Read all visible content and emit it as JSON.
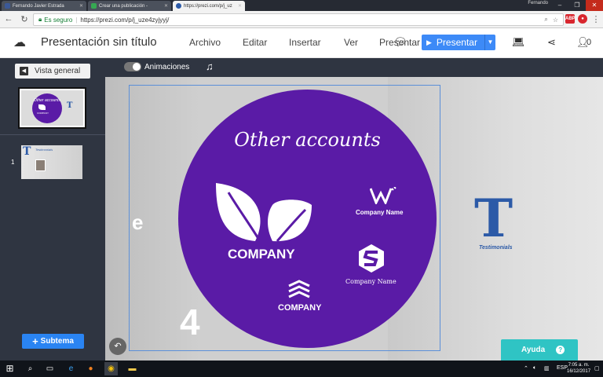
{
  "browser": {
    "tabs": [
      {
        "title": "Fernando Javier Estrada",
        "color": "#3b5998",
        "active": false
      },
      {
        "title": "Crear una publicación -",
        "color": "#36a852",
        "active": false
      },
      {
        "title": "https://prezi.com/p/j_uz",
        "color": "#2c5aa7",
        "active": true
      }
    ],
    "user": "Fernando",
    "secure_label": "Es seguro",
    "url": "https://prezi.com/p/j_uze4zyjyyj/"
  },
  "app": {
    "title": "Presentación sin título",
    "menu": [
      "Archivo",
      "Editar",
      "Insertar",
      "Ver",
      "Presentar"
    ],
    "present_label": "Presentar",
    "collab_count": "0"
  },
  "sidebar": {
    "overview_label": "Vista general",
    "thumb_number": "1",
    "thumb_title": "Testimonials",
    "subtopic_label": "Subtema"
  },
  "toolbar": {
    "animations_label": "Animaciones"
  },
  "canvas": {
    "circle_title": "Other accounts",
    "company_big": "COMPANY",
    "company_small": "COMPANY",
    "company_name_1": "Company Name",
    "company_name_2": "Company Name",
    "letter_e": "e",
    "number": "4",
    "testimonials_letter": "T",
    "testimonials_label": "Testimonials",
    "thumb_circle_title": "Other accounts",
    "thumb_company": "COMPANY",
    "thumb_t": "T"
  },
  "help": {
    "label": "Ayuda",
    "icon_text": "?"
  },
  "taskbar": {
    "lang": "ESP",
    "time": "7:05 a. m.",
    "date": "16/12/2017"
  },
  "colors": {
    "circle": "#5a1ba6",
    "present": "#3d8af7",
    "help": "#2fc4c4",
    "testimonials": "#2c5aa7"
  }
}
